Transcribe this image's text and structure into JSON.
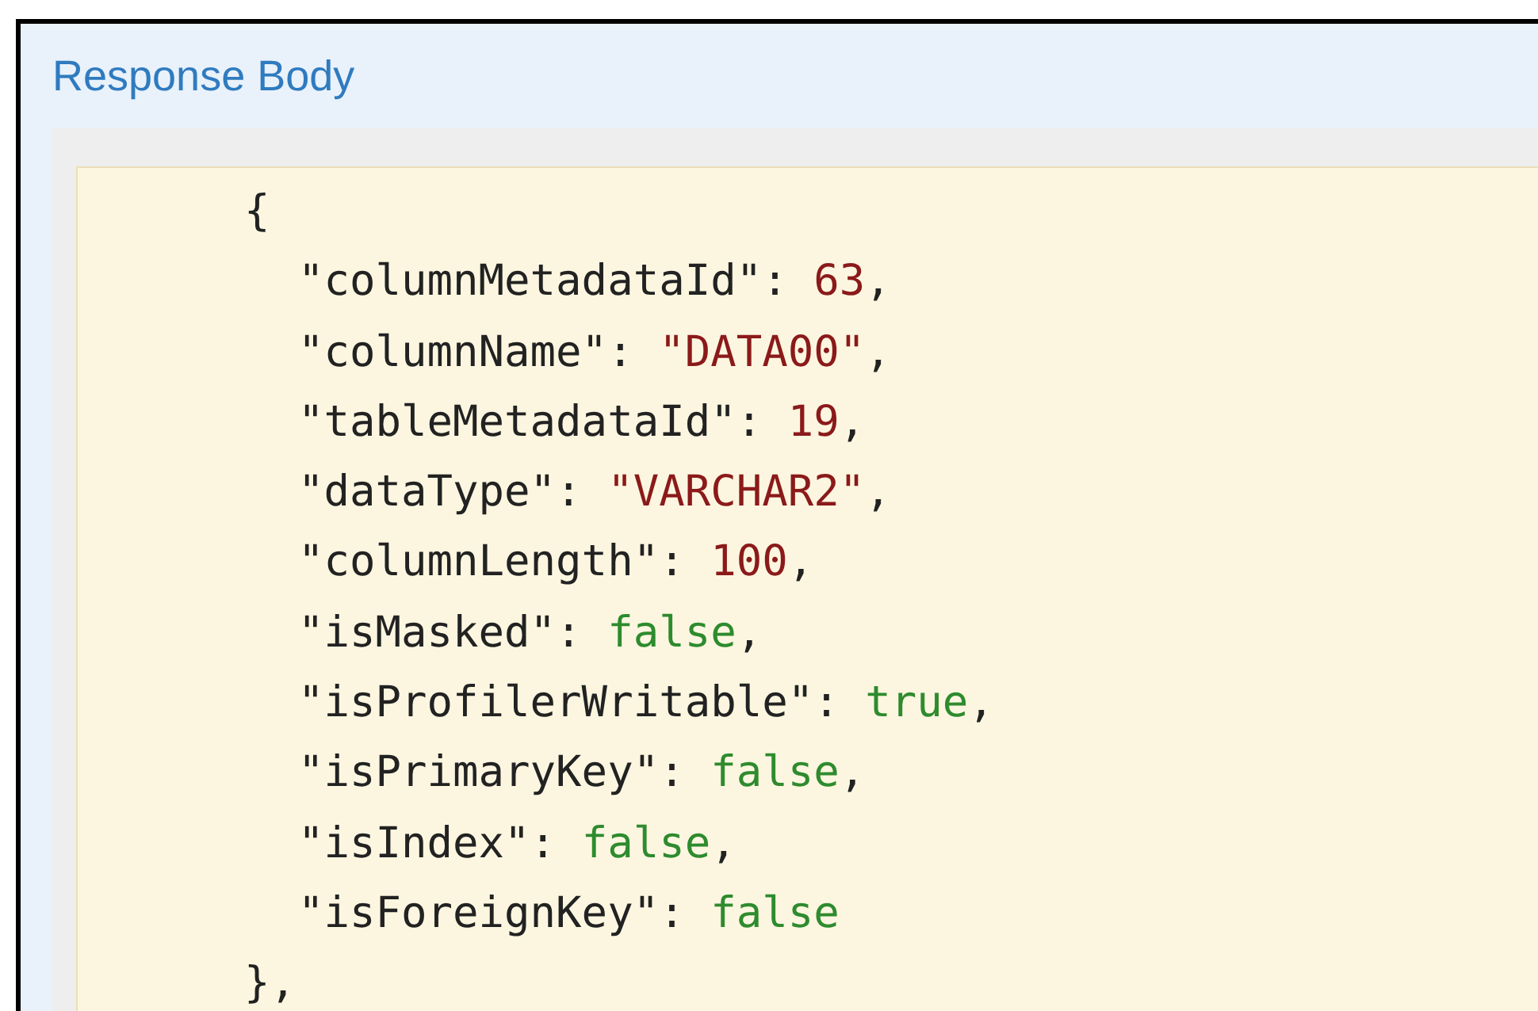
{
  "title": "Response Body",
  "object": {
    "open": "{",
    "close": "},",
    "fields": [
      {
        "key": "\"columnMetadataId\":",
        "value": "63",
        "kind": "number",
        "comma": ","
      },
      {
        "key": "\"columnName\":",
        "value": "\"DATA00\"",
        "kind": "string",
        "comma": ","
      },
      {
        "key": "\"tableMetadataId\":",
        "value": "19",
        "kind": "number",
        "comma": ","
      },
      {
        "key": "\"dataType\":",
        "value": "\"VARCHAR2\"",
        "kind": "string",
        "comma": ","
      },
      {
        "key": "\"columnLength\":",
        "value": "100",
        "kind": "number",
        "comma": ","
      },
      {
        "key": "\"isMasked\":",
        "value": "false",
        "kind": "boolean",
        "comma": ","
      },
      {
        "key": "\"isProfilerWritable\":",
        "value": "true",
        "kind": "boolean",
        "comma": ","
      },
      {
        "key": "\"isPrimaryKey\":",
        "value": "false",
        "kind": "boolean",
        "comma": ","
      },
      {
        "key": "\"isIndex\":",
        "value": "false",
        "kind": "boolean",
        "comma": ","
      },
      {
        "key": "\"isForeignKey\":",
        "value": "false",
        "kind": "boolean"
      }
    ]
  }
}
